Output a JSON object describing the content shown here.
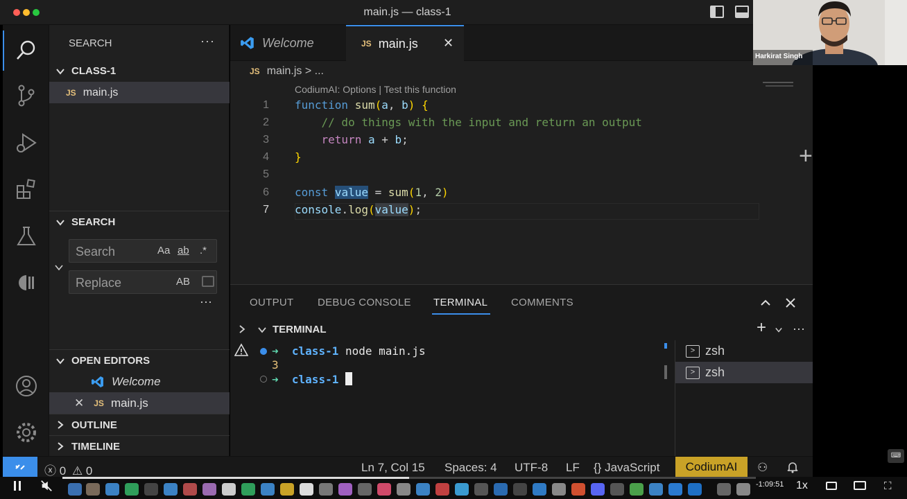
{
  "window": {
    "title": "main.js — class-1"
  },
  "activity_bar": [
    "search-icon",
    "source-control-icon",
    "run-debug-icon",
    "extensions-icon",
    "testing-icon",
    "codium-icon",
    "account-icon",
    "settings-gear-icon"
  ],
  "sidebar": {
    "title": "SEARCH",
    "folder": "CLASS-1",
    "folder_file": "main.js",
    "search_section": "SEARCH",
    "search_placeholder": "Search",
    "replace_placeholder": "Replace",
    "opt_case": "Aa",
    "opt_word": "ab",
    "opt_regex": ".*",
    "opt_preserve": "AB",
    "open_editors": "OPEN EDITORS",
    "open_editor_items": [
      "Welcome",
      "main.js"
    ],
    "outline": "OUTLINE",
    "timeline": "TIMELINE"
  },
  "tabs": {
    "welcome": "Welcome",
    "main": "main.js"
  },
  "editor": {
    "breadcrumb_file": "main.js",
    "breadcrumb_rest": "> ...",
    "codelens": "CodiumAI: Options | Test this function",
    "line_numbers": [
      "1",
      "2",
      "3",
      "4",
      "5",
      "6",
      "7"
    ]
  },
  "panel": {
    "tabs": [
      "OUTPUT",
      "DEBUG CONSOLE",
      "TERMINAL",
      "COMMENTS"
    ],
    "terminal_header": "TERMINAL",
    "term_dir": "class-1",
    "term_cmd": "node main.js",
    "term_output": "3",
    "term_instances": [
      "zsh",
      "zsh"
    ]
  },
  "statusbar": {
    "errors": "0",
    "warnings": "0",
    "position": "Ln 7, Col 15",
    "spaces": "Spaces: 4",
    "encoding": "UTF-8",
    "eol": "LF",
    "language": "JavaScript",
    "codium": "CodiumAI"
  },
  "player": {
    "time": "-1:09:51",
    "speed": "1x"
  },
  "webcam": {
    "name": "Harkirat Singh"
  },
  "colors": {
    "accent": "#3b8eea",
    "codium": "#c9a227"
  }
}
